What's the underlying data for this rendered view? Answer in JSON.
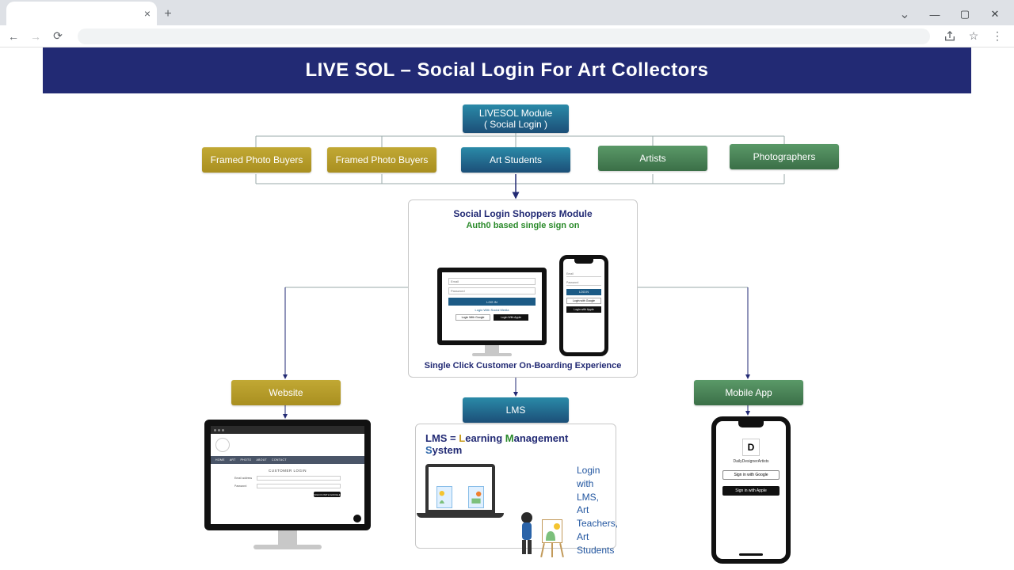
{
  "chrome": {
    "tab_title": "",
    "close": "×",
    "add": "+",
    "win": {
      "chev": "⌄",
      "min": "—",
      "max": "▢",
      "close": "✕"
    }
  },
  "banner": "LIVE SOL – Social Login For Art Collectors",
  "nodes": {
    "root_l1": "LIVESOL Module",
    "root_l2": "( Social Login )",
    "c1": "Framed Photo Buyers",
    "c2": "Framed Photo Buyers",
    "c3": "Art Students",
    "c4": "Artists",
    "c5": "Photographers",
    "website": "Website",
    "lms": "LMS",
    "mobile": "Mobile App"
  },
  "shoppers": {
    "title": "Social Login Shoppers Module",
    "sub": "Auth0 based single sign on",
    "foot": "Single Click Customer On-Boarding Experience",
    "email": "Email",
    "password": "Password",
    "login": "LOG IN",
    "lwm": "Login With Social Media",
    "google": "Login With Google",
    "apple": "Login With Apple",
    "ph_login": "LOG IN",
    "ph_google": "Login with Google",
    "ph_apple": "Login with Apple"
  },
  "website_mon": {
    "title": "CUSTOMER LOGIN",
    "email": "Email address",
    "password": "Password",
    "signin": "SIGN IN WITH GOOGLE"
  },
  "lms_card": {
    "prefix": "LMS = ",
    "L": "L",
    "Lrest": "earning ",
    "M": "M",
    "Mrest": "anagement ",
    "S": "S",
    "Srest": "ystem",
    "line1": "Login with LMS,",
    "line2": "Art Teachers,",
    "line3": "Art Students"
  },
  "phone": {
    "logo": "D",
    "brand": "DailyDesignerArtists",
    "google": "Sign in with Google",
    "apple": "Sign in with Apple"
  }
}
